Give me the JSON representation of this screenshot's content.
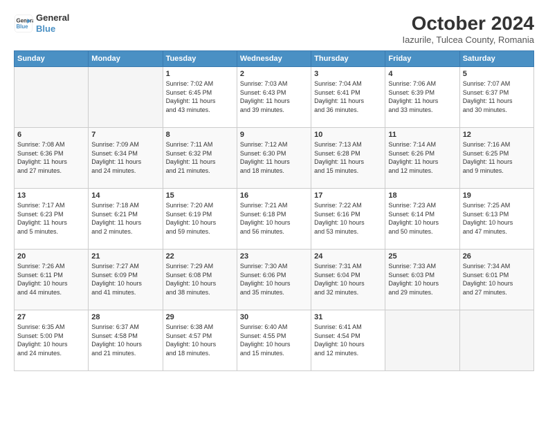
{
  "logo": {
    "line1": "General",
    "line2": "Blue"
  },
  "header": {
    "month": "October 2024",
    "location": "Iazurile, Tulcea County, Romania"
  },
  "weekdays": [
    "Sunday",
    "Monday",
    "Tuesday",
    "Wednesday",
    "Thursday",
    "Friday",
    "Saturday"
  ],
  "weeks": [
    [
      {
        "day": "",
        "content": ""
      },
      {
        "day": "",
        "content": ""
      },
      {
        "day": "1",
        "content": "Sunrise: 7:02 AM\nSunset: 6:45 PM\nDaylight: 11 hours\nand 43 minutes."
      },
      {
        "day": "2",
        "content": "Sunrise: 7:03 AM\nSunset: 6:43 PM\nDaylight: 11 hours\nand 39 minutes."
      },
      {
        "day": "3",
        "content": "Sunrise: 7:04 AM\nSunset: 6:41 PM\nDaylight: 11 hours\nand 36 minutes."
      },
      {
        "day": "4",
        "content": "Sunrise: 7:06 AM\nSunset: 6:39 PM\nDaylight: 11 hours\nand 33 minutes."
      },
      {
        "day": "5",
        "content": "Sunrise: 7:07 AM\nSunset: 6:37 PM\nDaylight: 11 hours\nand 30 minutes."
      }
    ],
    [
      {
        "day": "6",
        "content": "Sunrise: 7:08 AM\nSunset: 6:36 PM\nDaylight: 11 hours\nand 27 minutes."
      },
      {
        "day": "7",
        "content": "Sunrise: 7:09 AM\nSunset: 6:34 PM\nDaylight: 11 hours\nand 24 minutes."
      },
      {
        "day": "8",
        "content": "Sunrise: 7:11 AM\nSunset: 6:32 PM\nDaylight: 11 hours\nand 21 minutes."
      },
      {
        "day": "9",
        "content": "Sunrise: 7:12 AM\nSunset: 6:30 PM\nDaylight: 11 hours\nand 18 minutes."
      },
      {
        "day": "10",
        "content": "Sunrise: 7:13 AM\nSunset: 6:28 PM\nDaylight: 11 hours\nand 15 minutes."
      },
      {
        "day": "11",
        "content": "Sunrise: 7:14 AM\nSunset: 6:26 PM\nDaylight: 11 hours\nand 12 minutes."
      },
      {
        "day": "12",
        "content": "Sunrise: 7:16 AM\nSunset: 6:25 PM\nDaylight: 11 hours\nand 9 minutes."
      }
    ],
    [
      {
        "day": "13",
        "content": "Sunrise: 7:17 AM\nSunset: 6:23 PM\nDaylight: 11 hours\nand 5 minutes."
      },
      {
        "day": "14",
        "content": "Sunrise: 7:18 AM\nSunset: 6:21 PM\nDaylight: 11 hours\nand 2 minutes."
      },
      {
        "day": "15",
        "content": "Sunrise: 7:20 AM\nSunset: 6:19 PM\nDaylight: 10 hours\nand 59 minutes."
      },
      {
        "day": "16",
        "content": "Sunrise: 7:21 AM\nSunset: 6:18 PM\nDaylight: 10 hours\nand 56 minutes."
      },
      {
        "day": "17",
        "content": "Sunrise: 7:22 AM\nSunset: 6:16 PM\nDaylight: 10 hours\nand 53 minutes."
      },
      {
        "day": "18",
        "content": "Sunrise: 7:23 AM\nSunset: 6:14 PM\nDaylight: 10 hours\nand 50 minutes."
      },
      {
        "day": "19",
        "content": "Sunrise: 7:25 AM\nSunset: 6:13 PM\nDaylight: 10 hours\nand 47 minutes."
      }
    ],
    [
      {
        "day": "20",
        "content": "Sunrise: 7:26 AM\nSunset: 6:11 PM\nDaylight: 10 hours\nand 44 minutes."
      },
      {
        "day": "21",
        "content": "Sunrise: 7:27 AM\nSunset: 6:09 PM\nDaylight: 10 hours\nand 41 minutes."
      },
      {
        "day": "22",
        "content": "Sunrise: 7:29 AM\nSunset: 6:08 PM\nDaylight: 10 hours\nand 38 minutes."
      },
      {
        "day": "23",
        "content": "Sunrise: 7:30 AM\nSunset: 6:06 PM\nDaylight: 10 hours\nand 35 minutes."
      },
      {
        "day": "24",
        "content": "Sunrise: 7:31 AM\nSunset: 6:04 PM\nDaylight: 10 hours\nand 32 minutes."
      },
      {
        "day": "25",
        "content": "Sunrise: 7:33 AM\nSunset: 6:03 PM\nDaylight: 10 hours\nand 29 minutes."
      },
      {
        "day": "26",
        "content": "Sunrise: 7:34 AM\nSunset: 6:01 PM\nDaylight: 10 hours\nand 27 minutes."
      }
    ],
    [
      {
        "day": "27",
        "content": "Sunrise: 6:35 AM\nSunset: 5:00 PM\nDaylight: 10 hours\nand 24 minutes."
      },
      {
        "day": "28",
        "content": "Sunrise: 6:37 AM\nSunset: 4:58 PM\nDaylight: 10 hours\nand 21 minutes."
      },
      {
        "day": "29",
        "content": "Sunrise: 6:38 AM\nSunset: 4:57 PM\nDaylight: 10 hours\nand 18 minutes."
      },
      {
        "day": "30",
        "content": "Sunrise: 6:40 AM\nSunset: 4:55 PM\nDaylight: 10 hours\nand 15 minutes."
      },
      {
        "day": "31",
        "content": "Sunrise: 6:41 AM\nSunset: 4:54 PM\nDaylight: 10 hours\nand 12 minutes."
      },
      {
        "day": "",
        "content": ""
      },
      {
        "day": "",
        "content": ""
      }
    ]
  ]
}
